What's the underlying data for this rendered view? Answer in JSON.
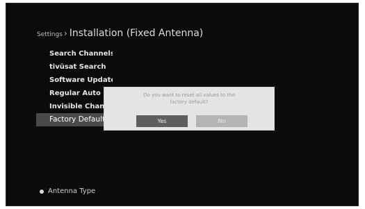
{
  "header": {
    "prefix": "Settings",
    "separator": "›",
    "title": "Installation (Fixed Antenna)"
  },
  "menu": {
    "items": [
      {
        "label": "Search Channels"
      },
      {
        "label": "tivūsat Search"
      },
      {
        "label": "Software Update"
      },
      {
        "label": "Regular Auto Update"
      },
      {
        "label": "Invisible Channels"
      },
      {
        "label": "Factory Default"
      }
    ],
    "selected_index": 5
  },
  "dialog": {
    "message_line1": "Do you want to reset all values to the",
    "message_line2": "factory default?",
    "yes_label": "Yes",
    "no_label": "No"
  },
  "footer": {
    "label": "Antenna Type"
  },
  "colors": {
    "screen_background": "#0b0b0b",
    "selected_row": "#4a4a4a",
    "dialog_background": "#e4e4e4",
    "yes_button": "#5e5e5e",
    "no_button": "#b4b4b4"
  }
}
